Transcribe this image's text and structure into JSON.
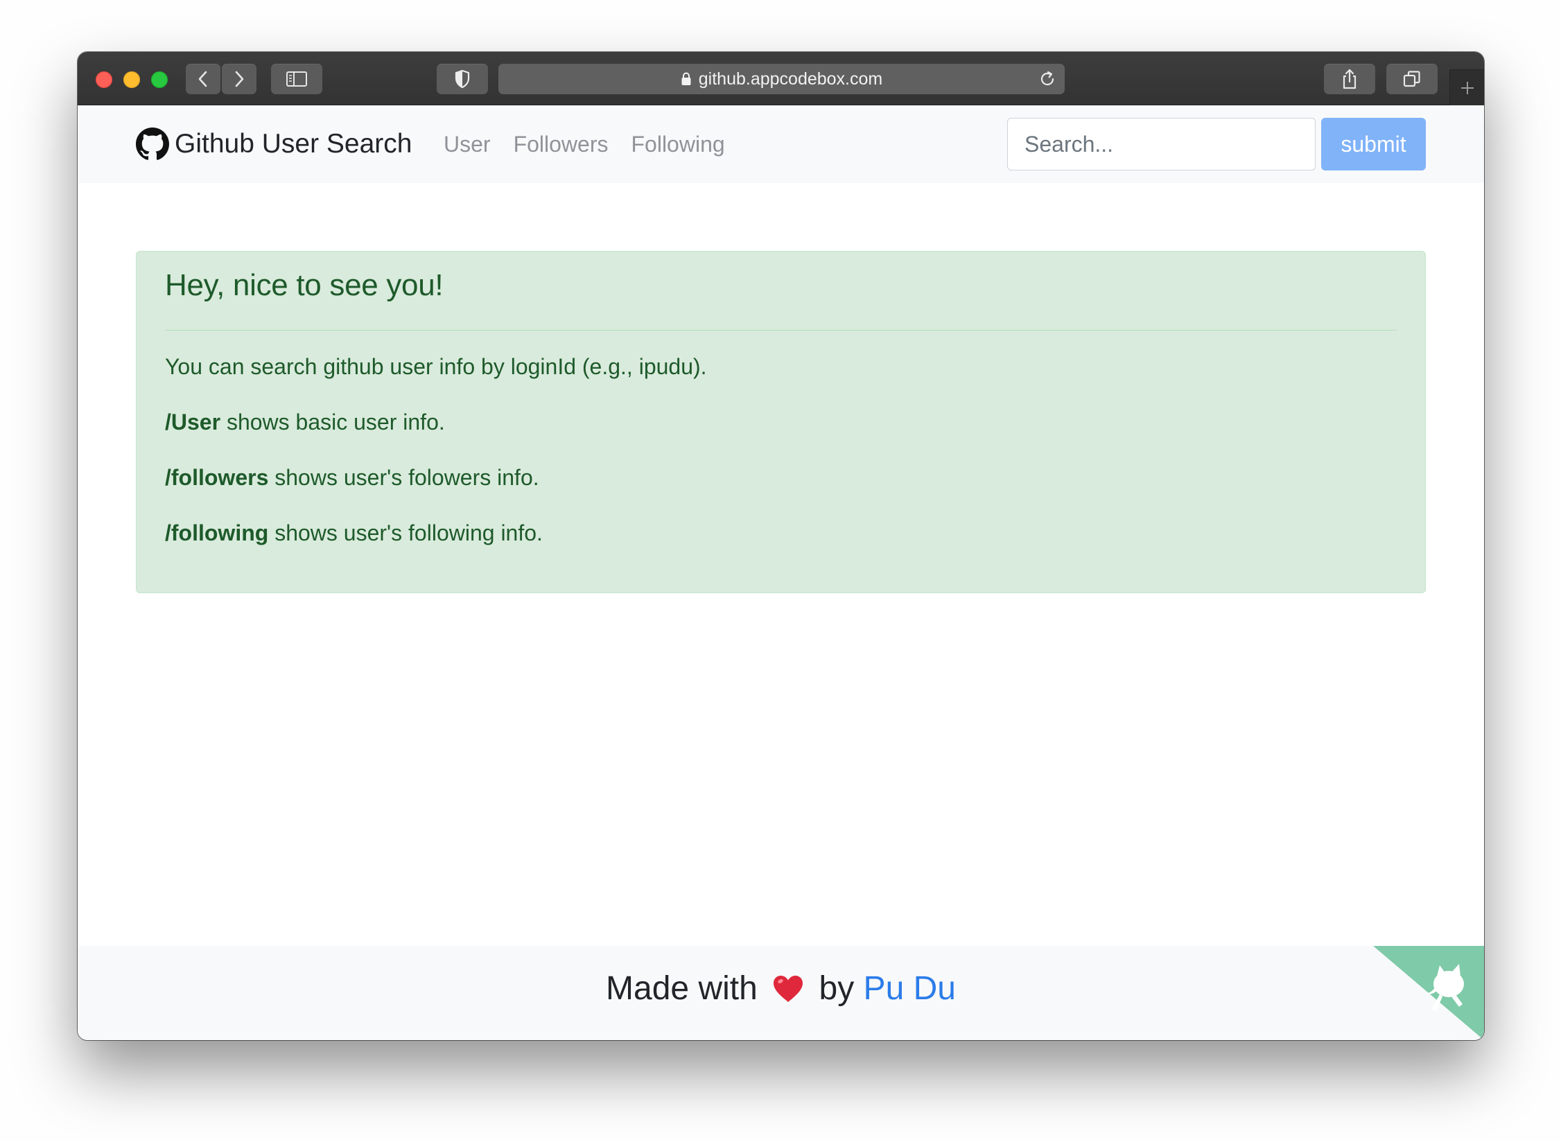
{
  "browser": {
    "url": "github.appcodebox.com"
  },
  "navbar": {
    "brand": "Github User Search",
    "links": [
      {
        "label": "User"
      },
      {
        "label": "Followers"
      },
      {
        "label": "Following"
      }
    ],
    "search_placeholder": "Search...",
    "submit_label": "submit"
  },
  "alert": {
    "heading": "Hey, nice to see you!",
    "intro": "You can search github user info by loginId (e.g., ipudu).",
    "lines": [
      {
        "command": "/User",
        "text": " shows basic user info."
      },
      {
        "command": "/followers",
        "text": " shows user's folowers info."
      },
      {
        "command": "/following",
        "text": " shows user's following info."
      }
    ]
  },
  "footer": {
    "made_with": "Made with",
    "by": "by",
    "author": "Pu Du"
  },
  "colors": {
    "alert_bg": "#d9ebdc",
    "alert_text": "#1e5a2b",
    "submit_bg": "#80b3f8",
    "link_blue": "#2b7ce9",
    "corner_green": "#7fcaa8"
  },
  "icons": [
    "github-octocat-icon",
    "heart-icon",
    "lock-icon",
    "reload-icon",
    "shield-icon",
    "share-icon",
    "tabs-icon",
    "sidebar-icon",
    "back-arrow-icon",
    "forward-arrow-icon",
    "plus-icon",
    "github-corner-icon"
  ]
}
